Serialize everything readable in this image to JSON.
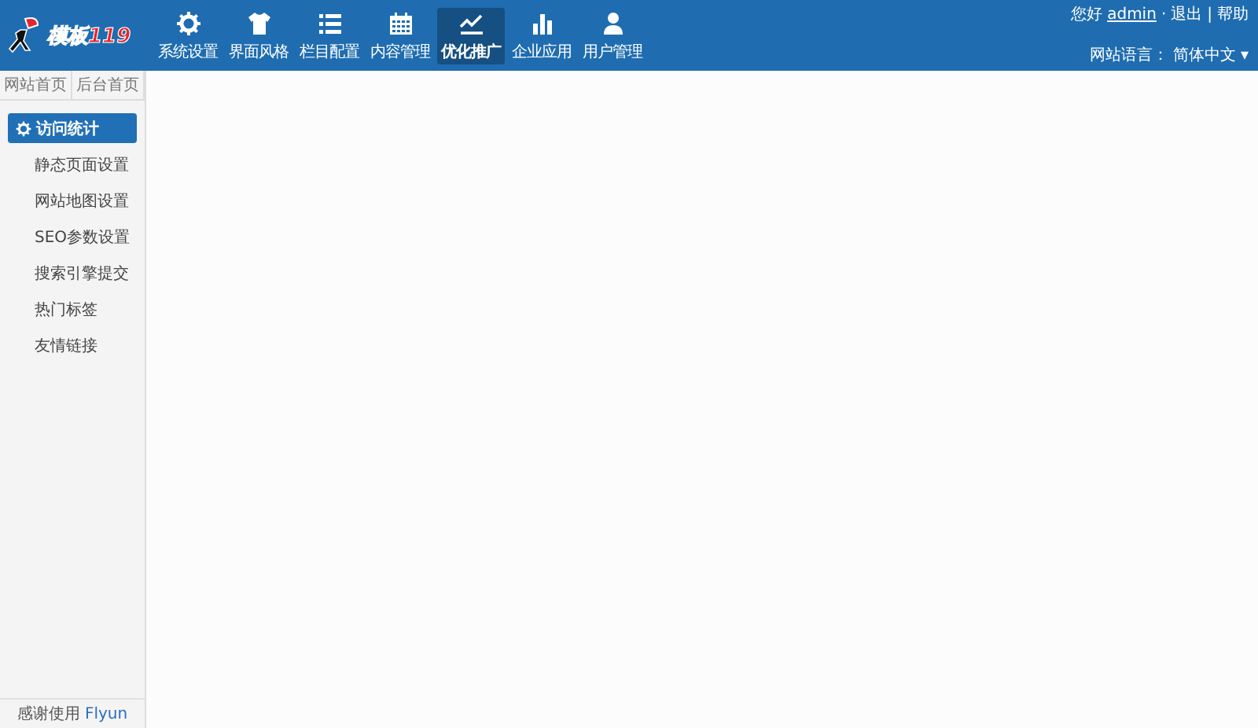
{
  "logo": {
    "text": "模板119"
  },
  "nav": [
    {
      "label": "系统设置",
      "selected": false
    },
    {
      "label": "界面风格",
      "selected": false
    },
    {
      "label": "栏目配置",
      "selected": false
    },
    {
      "label": "内容管理",
      "selected": false
    },
    {
      "label": "优化推广",
      "selected": true
    },
    {
      "label": "企业应用",
      "selected": false
    },
    {
      "label": "用户管理",
      "selected": false
    }
  ],
  "user_bar": {
    "greeting": "您好",
    "user": "admin",
    "sep1": "·",
    "logout": "退出",
    "sep2": "|",
    "help": "帮助"
  },
  "language": {
    "label": "网站语言：",
    "value": "简体中文",
    "caret": "▾"
  },
  "sidebar": {
    "tabs": [
      "网站首页",
      "后台首页"
    ],
    "items": [
      {
        "label": "访问统计",
        "selected": true
      },
      {
        "label": "静态页面设置",
        "selected": false
      },
      {
        "label": "网站地图设置",
        "selected": false
      },
      {
        "label": "SEO参数设置",
        "selected": false
      },
      {
        "label": "搜索引擎提交",
        "selected": false
      },
      {
        "label": "热门标签",
        "selected": false
      },
      {
        "label": "友情链接",
        "selected": false
      }
    ],
    "footer": {
      "text": "感谢使用",
      "link": "Flyun"
    }
  }
}
